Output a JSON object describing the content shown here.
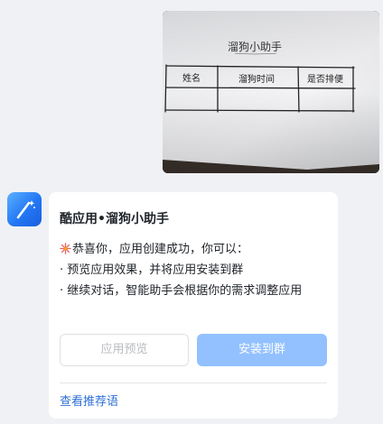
{
  "photo": {
    "icon": "handwritten-table-photo",
    "handwritten_title": "溜狗小助手",
    "handwritten_columns": [
      "姓名",
      "溜狗时间",
      "是否排便"
    ]
  },
  "bot": {
    "avatar_icon": "magic-wand-icon"
  },
  "card": {
    "title": "酷应用•溜狗小助手",
    "emoji_icon": "sparkles-icon",
    "message_line1": "恭喜你，应用创建成功，你可以：",
    "message_line2": "· 预览应用效果，并将应用安装到群",
    "message_line3": "· 继续对话，智能助手会根据你的需求调整应用",
    "preview_button": "应用预览",
    "install_button": "安装到群",
    "recommend_link": "查看推荐语"
  },
  "colors": {
    "background": "#f0f1f4",
    "card": "#ffffff",
    "install_button_disabled": "#93c1ff",
    "link": "#2f6fd6",
    "avatar": "#2377f4"
  }
}
